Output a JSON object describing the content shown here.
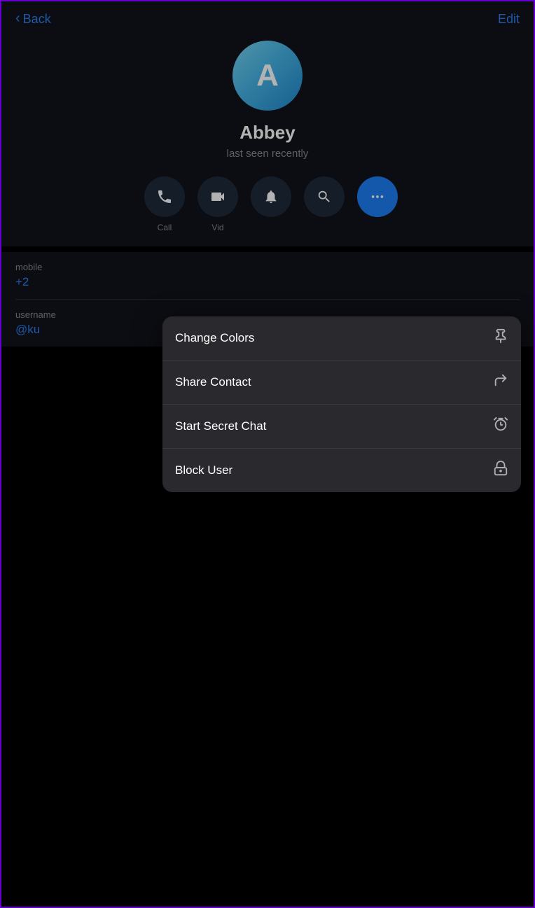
{
  "nav": {
    "back_label": "Back",
    "edit_label": "Edit"
  },
  "profile": {
    "avatar_letter": "A",
    "name": "Abbey",
    "status": "last seen recently"
  },
  "action_buttons": [
    {
      "id": "call",
      "label": "Call",
      "icon": "phone"
    },
    {
      "id": "video",
      "label": "Vid",
      "icon": "video"
    },
    {
      "id": "notify",
      "label": "",
      "icon": "bell"
    },
    {
      "id": "search",
      "label": "",
      "icon": "search"
    },
    {
      "id": "more",
      "label": "",
      "icon": "more",
      "active": true
    }
  ],
  "contact_info": [
    {
      "label": "mobile",
      "value": "+2"
    },
    {
      "label": "username",
      "value": "@ku"
    }
  ],
  "dropdown_menu": {
    "items": [
      {
        "id": "change-colors",
        "label": "Change Colors",
        "icon": "pin"
      },
      {
        "id": "share-contact",
        "label": "Share Contact",
        "icon": "share"
      },
      {
        "id": "start-secret-chat",
        "label": "Start Secret Chat",
        "icon": "timer"
      },
      {
        "id": "block-user",
        "label": "Block User",
        "icon": "block"
      }
    ]
  }
}
